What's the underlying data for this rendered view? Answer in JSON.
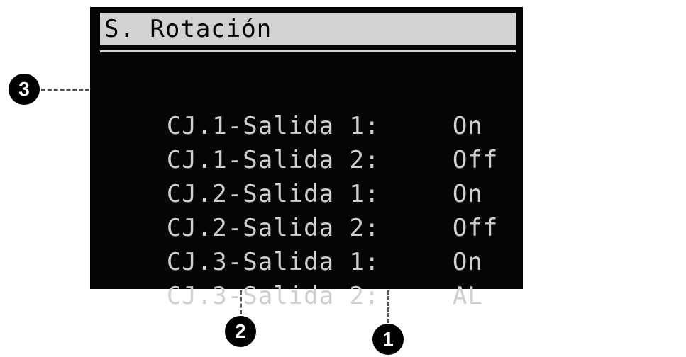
{
  "screen": {
    "title": "S. Rotación",
    "rows": [
      {
        "label": "CJ.1-Salida 1:",
        "value": "On"
      },
      {
        "label": "CJ.1-Salida 2:",
        "value": "Off"
      },
      {
        "label": "CJ.2-Salida 1:",
        "value": "On"
      },
      {
        "label": "CJ.2-Salida 2:",
        "value": "Off"
      },
      {
        "label": "CJ.3-Salida 1:",
        "value": "On"
      },
      {
        "label": "CJ.3-Salida 2:",
        "value": "AL"
      }
    ]
  },
  "callouts": [
    {
      "number": "1"
    },
    {
      "number": "2"
    },
    {
      "number": "3"
    }
  ],
  "colors": {
    "screen_bg": "#050505",
    "screen_text": "#cfcfcf",
    "title_bar": "#d2d2d2",
    "callout_bg": "#000000"
  }
}
